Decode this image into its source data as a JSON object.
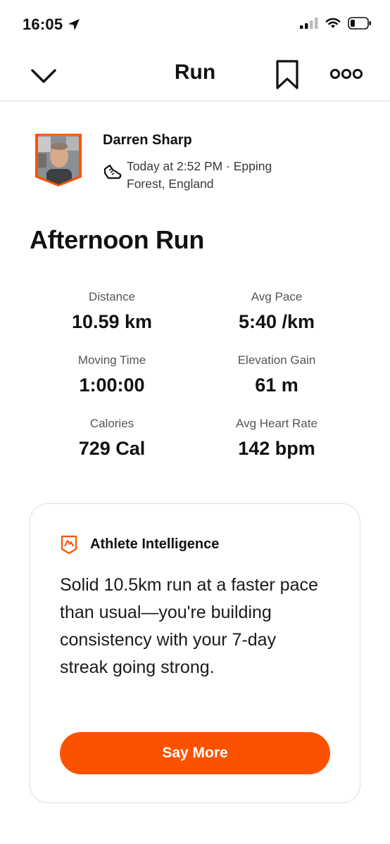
{
  "status_bar": {
    "time": "16:05",
    "icons": [
      "location-arrow-icon",
      "cellular-signal-icon",
      "wifi-icon",
      "battery-icon"
    ]
  },
  "nav": {
    "title": "Run",
    "icons": [
      "chevron-down-icon",
      "bookmark-icon",
      "more-icon"
    ]
  },
  "athlete": {
    "name": "Darren Sharp",
    "meta": "Today at 2:52 PM · Epping Forest, England"
  },
  "activity": {
    "title": "Afternoon Run",
    "stats": [
      {
        "label": "Distance",
        "value": "10.59 km"
      },
      {
        "label": "Avg Pace",
        "value": "5:40 /km"
      },
      {
        "label": "Moving Time",
        "value": "1:00:00"
      },
      {
        "label": "Elevation Gain",
        "value": "61 m"
      },
      {
        "label": "Calories",
        "value": "729 Cal"
      },
      {
        "label": "Avg Heart Rate",
        "value": "142 bpm"
      }
    ]
  },
  "athlete_intelligence": {
    "heading": "Athlete Intelligence",
    "summary": "Solid 10.5km run at a faster pace than usual—you're building consistency with your 7-day streak going strong.",
    "button_label": "Say More"
  },
  "colors": {
    "accent": "#fc5200",
    "text": "#111111",
    "muted": "#555555",
    "border": "#dddddd"
  }
}
